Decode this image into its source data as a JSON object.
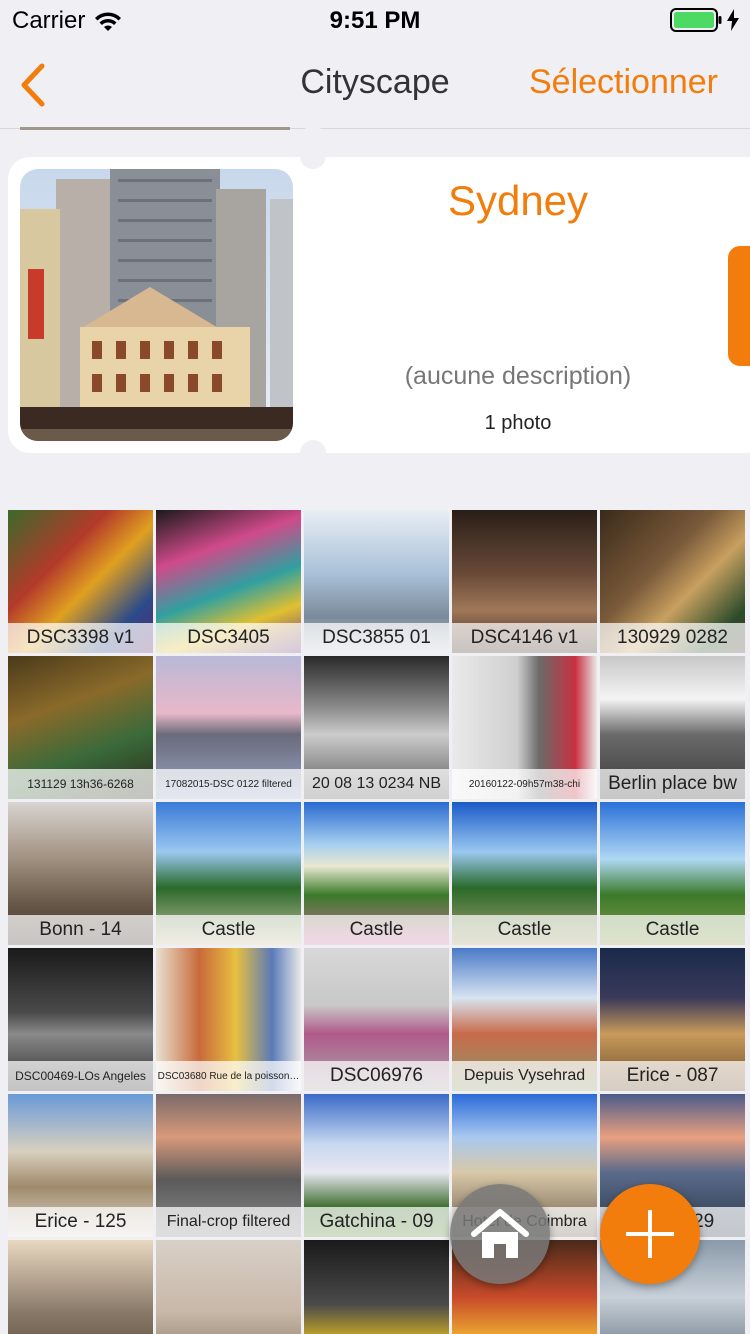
{
  "status_bar": {
    "carrier": "Carrier",
    "time": "9:51 PM"
  },
  "nav": {
    "title": "Cityscape",
    "select_label": "Sélectionner"
  },
  "album": {
    "name": "Sydney",
    "description": "(aucune description)",
    "count": "1 photo"
  },
  "colors": {
    "accent": "#f27d0c",
    "background": "#f0eff4",
    "battery": "#4cd964"
  },
  "icons": {
    "back": "chevron-left-icon",
    "home": "home-icon",
    "add": "plus-icon"
  },
  "photos": [
    {
      "label": "DSC3398 v1",
      "thumb": "linear-gradient(135deg,#3a6a2a 0%,#b33a2a 35%,#e0a020 55%,#2a4a8a 80%,#5a2a6a 100%)"
    },
    {
      "label": "DSC3405",
      "thumb": "linear-gradient(160deg,#1a1a1a 0%,#d04a8a 30%,#30a0a0 55%,#e0c030 75%,#6a3a8a 100%)"
    },
    {
      "label": "DSC3855 01",
      "thumb": "linear-gradient(180deg,#e8eef4 0%,#a8c0d8 45%,#7a8a9a 75%,#c8ccd0 100%)"
    },
    {
      "label": "DSC4146 v1",
      "thumb": "linear-gradient(180deg,#2a1e18 0%,#6a4a38 45%,#a07858 70%,#3a2a20 100%)"
    },
    {
      "label": "130929 0282",
      "thumb": "linear-gradient(135deg,#3a2a1a 0%,#7a5a3a 40%,#c8a060 60%,#2a4a2a 85%,#4a3a2a 100%)"
    },
    {
      "label": "131129 13h36-6268",
      "thumb": "linear-gradient(160deg,#4a3a1a 0%,#8a6a2a 35%,#3a6a3a 65%,#2a2a1a 100%)"
    },
    {
      "label": "17082015-DSC 0122 filtered",
      "thumb": "linear-gradient(180deg,#b8b8d8 0%,#e8b8c8 40%,#6a6a7a 55%,#98a8c8 100%)"
    },
    {
      "label": "20 08 13 0234 NB",
      "thumb": "linear-gradient(180deg,#2a2a2a 0%,#888 35%,#ccc 55%,#555 100%)"
    },
    {
      "label": "20160122-09h57m38-chi",
      "thumb": "linear-gradient(90deg,#eaeaea 0%,#cfcfcf 45%,#6a6a6a 60%,#c83040 85%,#e8e8e8 100%)"
    },
    {
      "label": "Berlin place bw",
      "thumb": "linear-gradient(180deg,#c8c8c8 0%,#f4f4f4 30%,#6a6a6a 55%,#3a3a3a 100%)"
    },
    {
      "label": "Bonn - 14",
      "thumb": "linear-gradient(180deg,#d8d4d0 0%,#a09080 40%,#6a5a4a 70%,#3a3028 100%)"
    },
    {
      "label": "Castle",
      "thumb": "linear-gradient(180deg,#3a7ad8 0%,#9ac8f0 35%,#2a6a2a 60%,#c8c0a0 100%)"
    },
    {
      "label": "Castle",
      "thumb": "linear-gradient(180deg,#2a6ad0 0%,#a8d0f0 30%,#e8e8d0 45%,#3a7a2a 65%,#d070a0 100%)"
    },
    {
      "label": "Castle",
      "thumb": "linear-gradient(180deg,#1a5ac8 0%,#9ac8f0 35%,#2a6a2a 60%,#a8a070 100%)"
    },
    {
      "label": "Castle",
      "thumb": "linear-gradient(180deg,#2a70d8 0%,#b0d8f4 40%,#3a7a2a 65%,#8a9a4a 100%)"
    },
    {
      "label": "DSC00469-LOs Angeles",
      "thumb": "linear-gradient(180deg,#1a1a1a 0%,#4a4a4a 45%,#8a8a8a 60%,#2a2a2a 100%)"
    },
    {
      "label": "DSC03680 Rue de la poisson…",
      "thumb": "linear-gradient(90deg,#e8e0d0 0%,#c86a3a 30%,#e8c040 55%,#5a7ab8 80%,#e8e8e8 100%)"
    },
    {
      "label": "DSC06976",
      "thumb": "linear-gradient(180deg,#d8d8d8 0%,#c8c8c8 40%,#b05a8a 60%,#a8a8a8 100%)"
    },
    {
      "label": "Depuis Vysehrad",
      "thumb": "linear-gradient(180deg,#4a7ac8 0%,#d8e4f0 35%,#c86a4a 60%,#8a9a6a 100%)"
    },
    {
      "label": "Erice - 087",
      "thumb": "linear-gradient(180deg,#1a2a4a 0%,#3a3a5a 35%,#c89a5a 60%,#6a4a2a 100%)"
    },
    {
      "label": "Erice - 125",
      "thumb": "linear-gradient(180deg,#6a9ad8 0%,#d8d0c0 40%,#a08a6a 65%,#e0dcd8 100%)"
    },
    {
      "label": "Final-crop filtered",
      "thumb": "linear-gradient(180deg,#7a6a6a 0%,#d89a7a 30%,#5a5a5a 60%,#8a8a8a 100%)"
    },
    {
      "label": "Gatchina - 09",
      "thumb": "linear-gradient(180deg,#3a6ac8 0%,#c8d8f0 35%,#e8e8f0 55%,#3a6a2a 80%,#5a8a3a 100%)"
    },
    {
      "label": "Hotel de Coimbra",
      "thumb": "linear-gradient(180deg,#2a6ad8 0%,#a8c8f0 30%,#d8c8a8 55%,#6a5a4a 100%)"
    },
    {
      "label": "IMG 1629",
      "thumb": "linear-gradient(180deg,#4a5a8a 0%,#e8a080 30%,#5a6a8a 55%,#2a3a4a 100%)"
    },
    {
      "label": "",
      "thumb": "linear-gradient(180deg,#e8d8c0 0%,#8a7a6a 50%,#4a3a2a 100%)"
    },
    {
      "label": "",
      "thumb": "linear-gradient(180deg,#d8d0c8 0%,#c8b8a8 50%,#7a6a5a 100%)"
    },
    {
      "label": "",
      "thumb": "linear-gradient(180deg,#1a1a1a 0%,#4a4a4a 45%,#e8c020 75%,#2a2a2a 100%)"
    },
    {
      "label": "",
      "thumb": "linear-gradient(180deg,#4a2a1a 0%,#c84a2a 40%,#e8a030 65%,#3a2a1a 100%)"
    },
    {
      "label": "",
      "thumb": "linear-gradient(180deg,#8a9aaa 0%,#c8d0d8 40%,#4a5a6a 100%)"
    }
  ]
}
